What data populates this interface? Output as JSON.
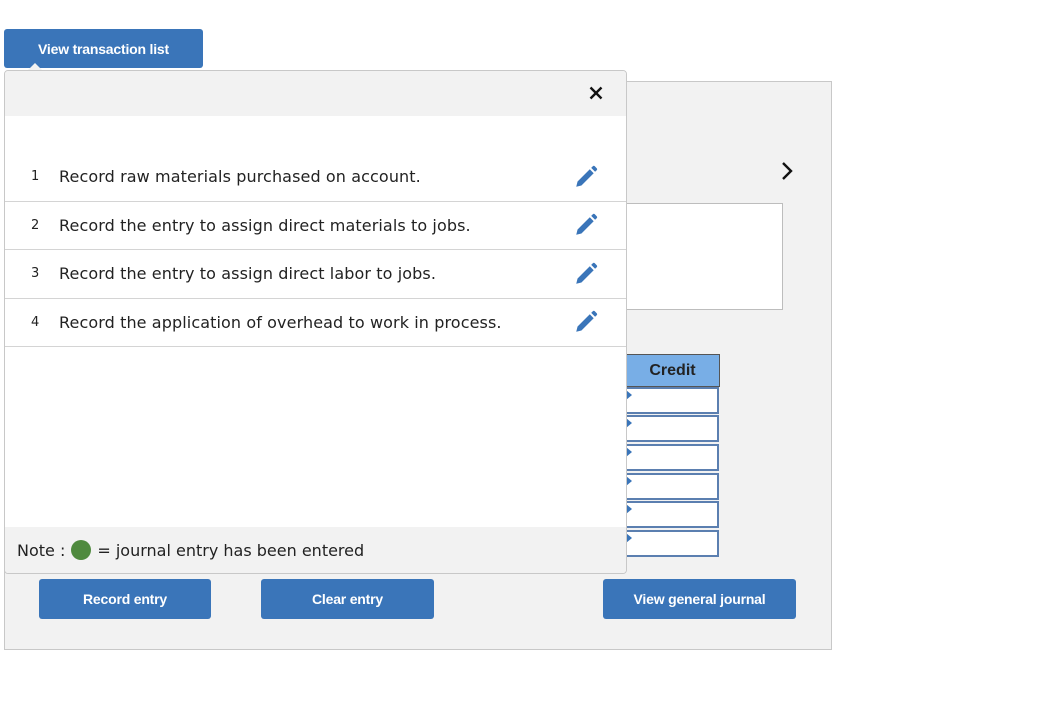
{
  "header": {
    "view_transaction_list_label": "View transaction list"
  },
  "popup": {
    "close_icon": "close-icon",
    "transactions": [
      {
        "number": "1",
        "text": "Record raw materials purchased on account.",
        "icon": "pencil-edit-icon"
      },
      {
        "number": "2",
        "text": "Record the entry to assign direct materials to jobs.",
        "icon": "pencil-edit-icon"
      },
      {
        "number": "3",
        "text": "Record the entry to assign direct labor to jobs.",
        "icon": "pencil-edit-icon"
      },
      {
        "number": "4",
        "text": "Record the application of overhead to work in process.",
        "icon": "pencil-edit-icon"
      }
    ],
    "note": {
      "prefix": "Note :",
      "suffix": "= journal entry has been entered",
      "dot_color": "#4f8a3e"
    }
  },
  "journal": {
    "next_arrow_icon": "chevron-right-icon",
    "credit_header": "Credit",
    "credit_values": [
      "",
      "",
      "",
      "",
      "",
      ""
    ]
  },
  "actions": {
    "record_entry_label": "Record entry",
    "clear_entry_label": "Clear entry",
    "view_general_journal_label": "View general journal"
  },
  "colors": {
    "accent": "#3a75b9",
    "credit_header_bg": "#78aee6",
    "panel_bg": "#f2f2f2"
  }
}
